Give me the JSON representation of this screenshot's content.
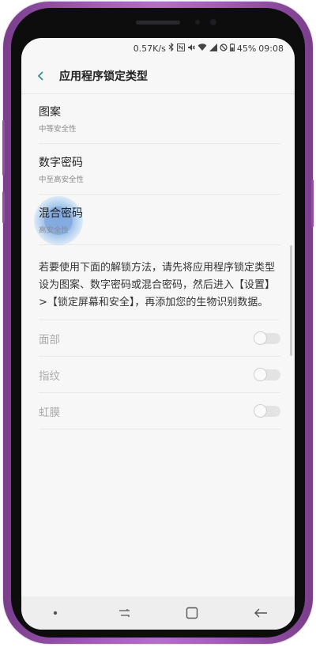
{
  "device": {
    "frame_color": "#a45cb8"
  },
  "status_bar": {
    "speed": "0.57K/s",
    "icons": [
      "bluetooth-icon",
      "nfc-icon",
      "mute-icon",
      "wifi-icon",
      "signal-icon",
      "no-disturb-icon"
    ],
    "battery": "45%",
    "time": "09:08"
  },
  "app_bar": {
    "title": "应用程序锁定类型",
    "back_icon": "back-chevron-icon"
  },
  "lock_options": [
    {
      "title": "图案",
      "subtitle": "中等安全性"
    },
    {
      "title": "数字密码",
      "subtitle": "中至高安全性"
    },
    {
      "title": "混合密码",
      "subtitle": "高安全性",
      "tapped": true
    }
  ],
  "info_text": "若要使用下面的解锁方法，请先将应用程序锁定类型设为图案、数字密码或混合密码，然后进入【设置】>【锁定屏幕和安全】，再添加您的生物识别数据。",
  "biometrics": [
    {
      "label": "面部",
      "enabled": false
    },
    {
      "label": "指纹",
      "enabled": false
    },
    {
      "label": "虹膜",
      "enabled": false
    }
  ],
  "nav_bar": {
    "items": [
      "dot-icon",
      "recents-icon",
      "home-icon",
      "back-arrow-icon"
    ]
  }
}
